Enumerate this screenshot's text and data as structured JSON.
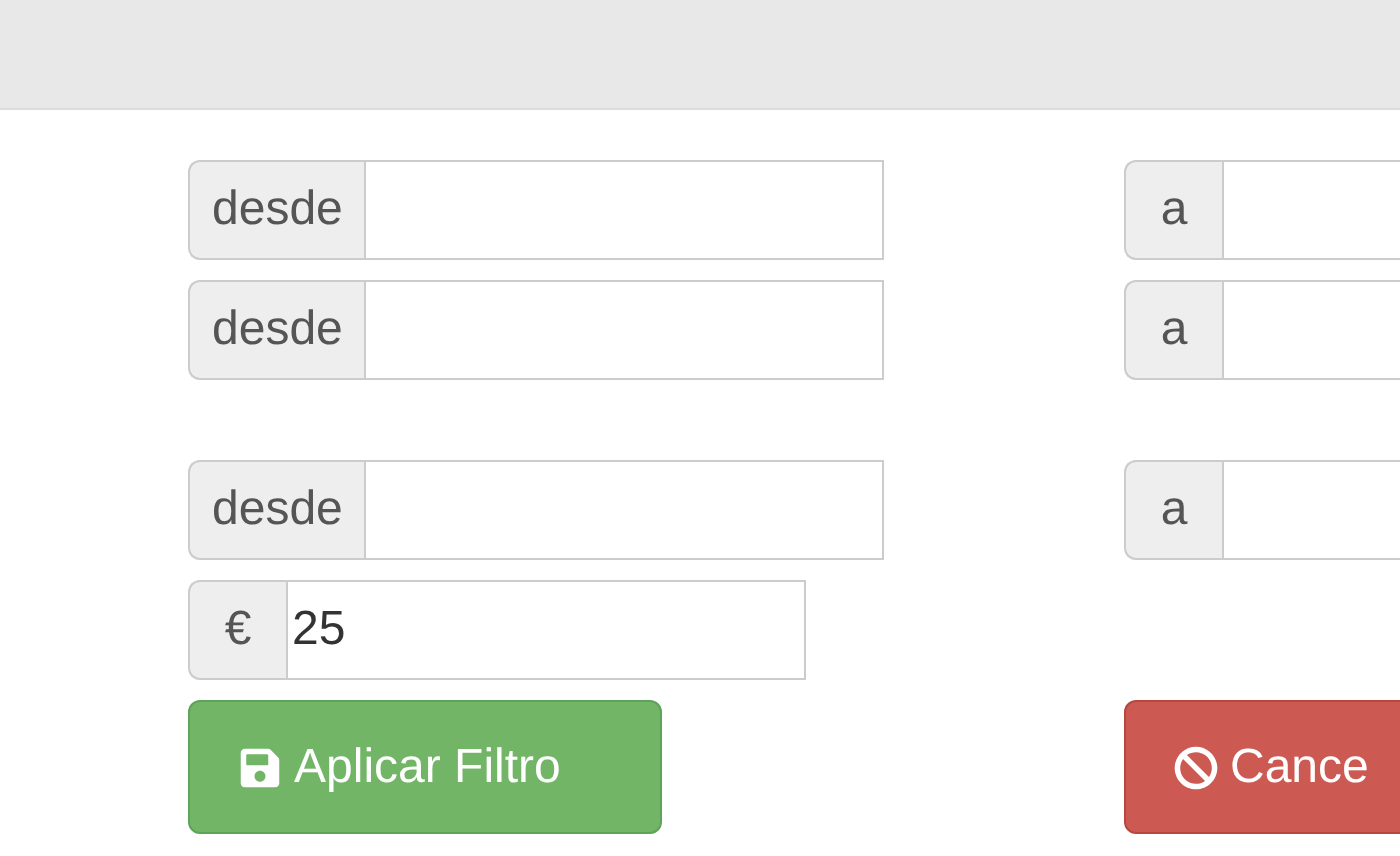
{
  "filter_groups": [
    {
      "rows": [
        {
          "kind": "range",
          "from": {
            "addon": "desde"
          },
          "to": {
            "addon": "a"
          }
        },
        {
          "kind": "range",
          "from": {
            "addon": "desde"
          },
          "to": {
            "addon": "a"
          }
        }
      ]
    },
    {
      "rows": [
        {
          "kind": "range",
          "from": {
            "addon": "desde"
          },
          "to": {
            "addon": "a"
          }
        },
        {
          "kind": "single",
          "from": {
            "addon": "€",
            "value": "25"
          }
        }
      ]
    }
  ],
  "buttons": [
    {
      "kind": "apply",
      "label": "Aplicar Filtro"
    },
    {
      "kind": "cancel",
      "label": "Cance"
    }
  ]
}
